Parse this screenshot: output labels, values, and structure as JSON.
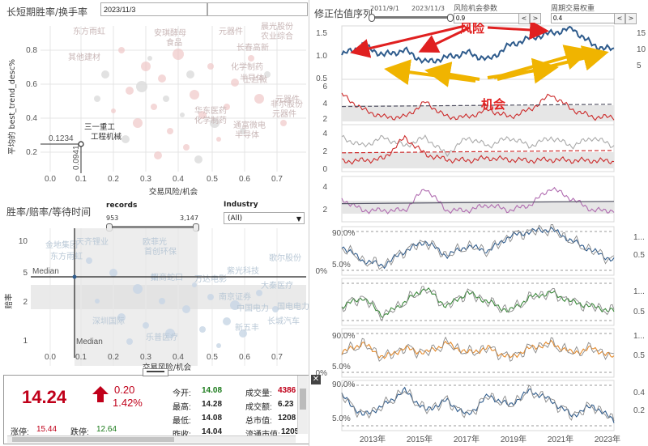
{
  "topbar": {
    "scatter_title": "长短期胜率/换手率",
    "date_value": "2023/11/3",
    "right_title": "修正估值序列",
    "slider1_left": "2011/9/1",
    "slider1_right": "2023/11/3",
    "risk_param_label": "风险机会参数",
    "risk_param_value": "0.9",
    "weight_label": "周期交易权重",
    "weight_value": "0.4"
  },
  "annotations": {
    "risk": "风险",
    "opportunity": "机会"
  },
  "scatter1": {
    "ylabel": "平均的 best_trend_desc%",
    "xlabel": "交易风险/机会",
    "x_ticks": [
      "0.0",
      "0.1",
      "0.2",
      "0.3",
      "0.4",
      "0.5",
      "0.6",
      "0.7"
    ],
    "y_ticks": [
      "0.8",
      "0.6",
      "0.4",
      "0.2"
    ],
    "crosshair_x": "0.0941",
    "crosshair_y": "0.1234",
    "point_label": [
      "三一重工",
      "工程机械"
    ],
    "bg_labels": [
      "东方雨虹",
      "其他建材",
      "安琪酵母",
      "食品",
      "元器件",
      "晨光股份",
      "农业综合",
      "长春高新",
      "化学制药",
      "士兰微",
      "半导体",
      "通富微电",
      "半导体",
      "华东医药",
      "化学制药",
      "元器件",
      "非尔股份",
      "元器件"
    ]
  },
  "scatter2": {
    "title": "胜率/赔率/等待时间",
    "records_label": "records",
    "records_min": "953",
    "records_max": "3,147",
    "industry_label": "Industry",
    "industry_value": "(All)",
    "ylabel": "赔率",
    "xlabel": "交易风险/机会",
    "x_ticks": [
      "0.0",
      "0.1",
      "0.2",
      "0.3",
      "0.4",
      "0.5",
      "0.6",
      "0.7"
    ],
    "y_ticks": [
      "10",
      "5",
      "2",
      "1"
    ],
    "median_label": "Median",
    "bg_labels": [
      "金地集团",
      "东方雨虹",
      "天齐锂业",
      "欧菲光",
      "首创环保",
      "招商蛇口",
      "大秦医疗",
      "歌尔股份",
      "中国电力",
      "新五丰",
      "长城汽车",
      "国电电力",
      "深圳国际",
      "南京证券",
      "万达电影",
      "紫光科技",
      "乐普医疗"
    ]
  },
  "quote": {
    "price": "14.24",
    "change": "0.20",
    "change_pct": "1.42%",
    "open_label": "今开:",
    "open": "14.08",
    "high_label": "最高:",
    "high": "14.28",
    "low_label": "最低:",
    "low": "14.08",
    "prev_label": "昨收:",
    "prev": "14.04",
    "vol_label": "成交量:",
    "vol": "4386",
    "amt_label": "成交额:",
    "amt": "6.23",
    "mcap_label": "总市值:",
    "mcap": "1208",
    "float_label": "流通市值:",
    "float": "1205",
    "limit_up_label": "涨停:",
    "limit_up": "15.44",
    "limit_down_label": "跌停:",
    "limit_down": "12.64"
  },
  "chart_data": [
    {
      "type": "line",
      "title": "修正估值序列",
      "ylim": [
        0.5,
        1.6
      ],
      "y_right": [
        5,
        10,
        15
      ],
      "series": [
        {
          "values": [
            1.0,
            1.2,
            1.0,
            1.1,
            0.85,
            0.95,
            1.05,
            0.9,
            1.2,
            1.35,
            1.45,
            1.55,
            1.2,
            1.1
          ]
        }
      ]
    },
    {
      "type": "line",
      "ylim": [
        1,
        7
      ],
      "y_ticks": [
        2,
        4,
        6
      ],
      "series": [
        {
          "values": [
            5,
            3,
            2,
            2,
            4,
            2,
            2,
            3,
            2,
            3,
            5,
            3,
            2,
            2
          ]
        }
      ]
    },
    {
      "type": "line",
      "ylim": [
        -1,
        4.5
      ],
      "y_ticks": [
        0,
        2,
        4
      ],
      "series": [
        {
          "values": [
            3,
            2,
            3,
            2,
            3,
            1,
            3,
            2,
            3,
            2,
            3,
            2,
            3,
            2
          ]
        },
        {
          "values": [
            0.2,
            0.3,
            0.5,
            3,
            1,
            0.4,
            0.3,
            0.6,
            0.4,
            0.3,
            0.4,
            0.3,
            0.3,
            0.2
          ]
        }
      ]
    },
    {
      "type": "line",
      "ylim": [
        1,
        5
      ],
      "y_ticks": [
        2,
        4
      ],
      "series": [
        {
          "values": [
            3,
            2,
            2,
            2,
            4,
            2,
            2,
            2.5,
            2,
            2.5,
            4,
            3,
            2,
            2
          ]
        }
      ]
    },
    {
      "type": "line",
      "y_ticks": [
        "90.0%",
        "5.0%",
        "0%"
      ],
      "y_right": [
        "1...",
        "0.5"
      ],
      "series": [
        {
          "values": [
            0.6,
            0.3,
            0.2,
            0.5,
            0.7,
            0.4,
            0.6,
            0.5,
            0.8,
            0.9,
            0.95,
            0.7,
            0.5,
            0.3
          ]
        }
      ]
    },
    {
      "type": "line",
      "y_ticks": [
        "0%"
      ],
      "y_right": [
        "1...",
        "0.5"
      ],
      "series": [
        {
          "values": [
            0.4,
            0.6,
            0.2,
            0.5,
            0.8,
            0.4,
            0.7,
            0.5,
            0.3,
            0.6,
            0.7,
            0.5,
            0.4,
            0.3
          ]
        }
      ]
    },
    {
      "type": "line",
      "y_ticks": [
        "90.0%",
        "5.0%",
        "0%"
      ],
      "y_right": [
        "1...",
        "0.5"
      ],
      "series": [
        {
          "values": [
            0.5,
            0.7,
            0.4,
            0.6,
            0.5,
            0.7,
            0.5,
            0.6,
            0.4,
            0.6,
            0.7,
            0.5,
            0.6,
            0.4
          ]
        }
      ]
    },
    {
      "type": "line",
      "x_ticks": [
        "2013年",
        "2015年",
        "2017年",
        "2019年",
        "2021年",
        "2023年"
      ],
      "y_ticks": [
        "90.0%",
        "5.0%"
      ],
      "y_right": [
        "0.4",
        "0.2"
      ],
      "series": [
        {
          "values": [
            0.7,
            0.3,
            0.5,
            0.8,
            0.4,
            0.6,
            0.3,
            0.7,
            0.5,
            0.8,
            0.6,
            0.3,
            0.5,
            0.2
          ]
        }
      ]
    }
  ]
}
